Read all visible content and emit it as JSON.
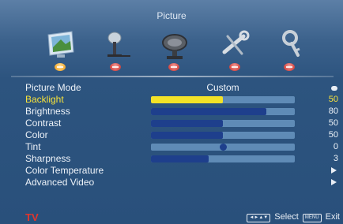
{
  "menu_title": "Picture",
  "tabs": [
    {
      "icon": "picture-monitor-icon",
      "active": true
    },
    {
      "icon": "audio-microphone-icon",
      "active": false
    },
    {
      "icon": "tv-satellite-icon",
      "active": false
    },
    {
      "icon": "setup-tools-icon",
      "active": false
    },
    {
      "icon": "parental-key-icon",
      "active": false
    }
  ],
  "items": [
    {
      "label": "Picture Mode",
      "value": "Custom",
      "kind": "select"
    },
    {
      "label": "Backlight",
      "value": "50",
      "level": 0.5,
      "kind": "slider",
      "selected": true
    },
    {
      "label": "Brightness",
      "value": "80",
      "level": 0.8,
      "kind": "slider"
    },
    {
      "label": "Contrast",
      "value": "50",
      "level": 0.5,
      "kind": "slider"
    },
    {
      "label": "Color",
      "value": "50",
      "level": 0.5,
      "kind": "slider"
    },
    {
      "label": "Tint",
      "value": "0",
      "level": 0.0,
      "kind": "center-slider"
    },
    {
      "label": "Sharpness",
      "value": "3",
      "level": 0.4,
      "kind": "slider"
    },
    {
      "label": "Color Temperature",
      "kind": "submenu"
    },
    {
      "label": "Advanced Video",
      "kind": "submenu"
    }
  ],
  "footer": {
    "source": "TV",
    "nav_key": "◄►▲▼",
    "select_label": "Select",
    "menu_key": "MENU",
    "exit_label": "Exit"
  },
  "colors": {
    "selected_text": "#f6e23a",
    "bar_track": "#5f8bb6",
    "bar_fill": "#1e3f8c",
    "selected_fill": "#f3e227",
    "source_label": "#e3352b"
  }
}
